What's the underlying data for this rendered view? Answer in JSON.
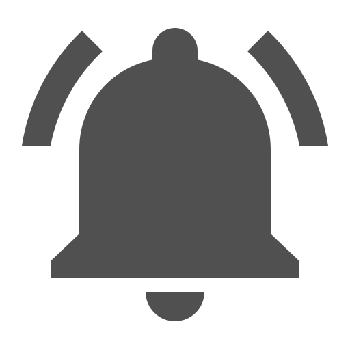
{
  "icon": {
    "name": "notification-bell-ringing-icon",
    "color": "#505050",
    "background": "#ffffff"
  }
}
